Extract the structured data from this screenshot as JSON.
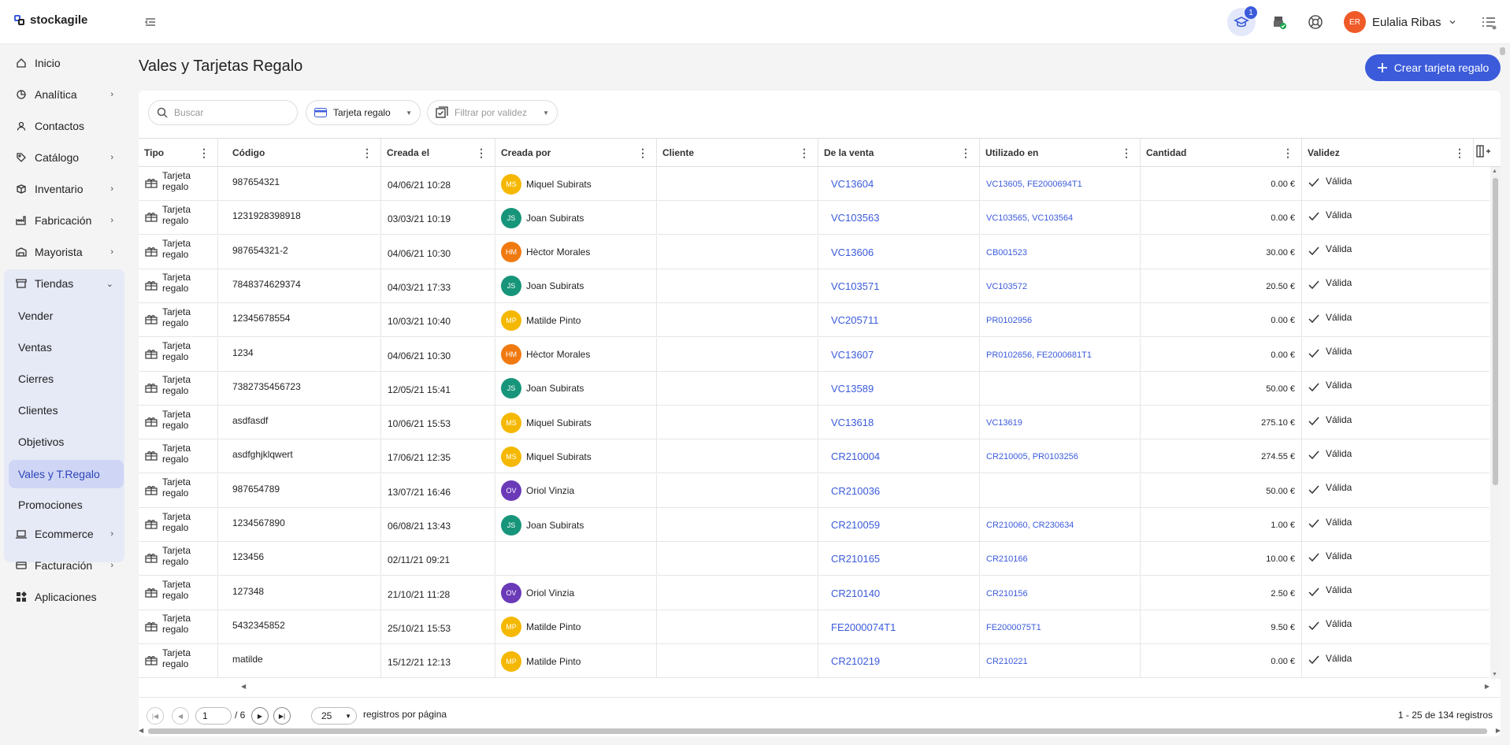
{
  "app": {
    "logo_text": "stockagile"
  },
  "header": {
    "academy_badge": "1",
    "user_initials": "ER",
    "user_name": "Eulalia Ribas"
  },
  "sidebar": {
    "items": [
      {
        "label": "Inicio",
        "icon": "home-icon"
      },
      {
        "label": "Analítica",
        "icon": "chart-icon"
      },
      {
        "label": "Contactos",
        "icon": "user-icon"
      },
      {
        "label": "Catálogo",
        "icon": "tag-icon"
      },
      {
        "label": "Inventario",
        "icon": "box-icon"
      },
      {
        "label": "Fabricación",
        "icon": "factory-icon"
      },
      {
        "label": "Mayorista",
        "icon": "warehouse-icon"
      },
      {
        "label": "Tiendas",
        "icon": "store-icon"
      },
      {
        "label": "Ecommerce",
        "icon": "laptop-icon"
      },
      {
        "label": "Facturación",
        "icon": "invoice-icon"
      },
      {
        "label": "Aplicaciones",
        "icon": "apps-icon"
      }
    ],
    "tiendas_sub": [
      "Vender",
      "Ventas",
      "Cierres",
      "Clientes",
      "Objetivos",
      "Vales y T.Regalo",
      "Promociones"
    ]
  },
  "page": {
    "title": "Vales y Tarjetas Regalo",
    "create_button": "Crear tarjeta regalo"
  },
  "filters": {
    "search_placeholder": "Buscar",
    "type_filter": "Tarjeta regalo",
    "validity_filter": "Filtrar por validez"
  },
  "table": {
    "columns": [
      "Tipo",
      "Código",
      "Creada el",
      "Creada por",
      "Cliente",
      "De la venta",
      "Utilizado en",
      "Cantidad",
      "Validez"
    ],
    "rows": [
      {
        "tipo": "Tarjeta regalo",
        "codigo": "987654321",
        "creada": "04/06/21 10:28",
        "ini": "MS",
        "por": "Miquel Subirats",
        "cliente": "",
        "venta": "VC13604",
        "usado": "VC13605, FE2000694T1",
        "cant": "0.00 €",
        "valid": "Válida"
      },
      {
        "tipo": "Tarjeta regalo",
        "codigo": "1231928398918",
        "creada": "03/03/21 10:19",
        "ini": "JS",
        "por": "Joan Subirats",
        "cliente": "",
        "venta": "VC103563",
        "usado": "VC103565, VC103564",
        "cant": "0.00 €",
        "valid": "Válida"
      },
      {
        "tipo": "Tarjeta regalo",
        "codigo": "987654321-2",
        "creada": "04/06/21 10:30",
        "ini": "HM",
        "por": "Hèctor Morales",
        "cliente": "",
        "venta": "VC13606",
        "usado": "CB001523",
        "cant": "30.00 €",
        "valid": "Válida"
      },
      {
        "tipo": "Tarjeta regalo",
        "codigo": "7848374629374",
        "creada": "04/03/21 17:33",
        "ini": "JS",
        "por": "Joan Subirats",
        "cliente": "",
        "venta": "VC103571",
        "usado": "VC103572",
        "cant": "20.50 €",
        "valid": "Válida"
      },
      {
        "tipo": "Tarjeta regalo",
        "codigo": "12345678554",
        "creada": "10/03/21 10:40",
        "ini": "MP",
        "por": "Matilde Pinto",
        "cliente": "",
        "venta": "VC205711",
        "usado": "PR0102956",
        "cant": "0.00 €",
        "valid": "Válida"
      },
      {
        "tipo": "Tarjeta regalo",
        "codigo": "1234",
        "creada": "04/06/21 10:30",
        "ini": "HM",
        "por": "Hèctor Morales",
        "cliente": "",
        "venta": "VC13607",
        "usado": "PR0102656, FE2000681T1",
        "cant": "0.00 €",
        "valid": "Válida"
      },
      {
        "tipo": "Tarjeta regalo",
        "codigo": "7382735456723",
        "creada": "12/05/21 15:41",
        "ini": "JS",
        "por": "Joan Subirats",
        "cliente": "",
        "venta": "VC13589",
        "usado": "",
        "cant": "50.00 €",
        "valid": "Válida"
      },
      {
        "tipo": "Tarjeta regalo",
        "codigo": "asdfasdf",
        "creada": "10/06/21 15:53",
        "ini": "MS",
        "por": "Miquel Subirats",
        "cliente": "",
        "venta": "VC13618",
        "usado": "VC13619",
        "cant": "275.10 €",
        "valid": "Válida"
      },
      {
        "tipo": "Tarjeta regalo",
        "codigo": "asdfghjklqwert",
        "creada": "17/06/21 12:35",
        "ini": "MS",
        "por": "Miquel Subirats",
        "cliente": "",
        "venta": "CR210004",
        "usado": "CR210005, PR0103256",
        "cant": "274.55 €",
        "valid": "Válida"
      },
      {
        "tipo": "Tarjeta regalo",
        "codigo": "987654789",
        "creada": "13/07/21 16:46",
        "ini": "OV",
        "por": "Oriol Vinzia",
        "cliente": "",
        "venta": "CR210036",
        "usado": "",
        "cant": "50.00 €",
        "valid": "Válida"
      },
      {
        "tipo": "Tarjeta regalo",
        "codigo": "1234567890",
        "creada": "06/08/21 13:43",
        "ini": "JS",
        "por": "Joan Subirats",
        "cliente": "",
        "venta": "CR210059",
        "usado": "CR210060, CR230634",
        "cant": "1.00 €",
        "valid": "Válida"
      },
      {
        "tipo": "Tarjeta regalo",
        "codigo": "123456",
        "creada": "02/11/21 09:21",
        "ini": "",
        "por": "",
        "cliente": "",
        "venta": "CR210165",
        "usado": "CR210166",
        "cant": "10.00 €",
        "valid": "Válida"
      },
      {
        "tipo": "Tarjeta regalo",
        "codigo": "127348",
        "creada": "21/10/21 11:28",
        "ini": "OV",
        "por": "Oriol Vinzia",
        "cliente": "",
        "venta": "CR210140",
        "usado": "CR210156",
        "cant": "2.50 €",
        "valid": "Válida"
      },
      {
        "tipo": "Tarjeta regalo",
        "codigo": "5432345852",
        "creada": "25/10/21 15:53",
        "ini": "MP",
        "por": "Matilde Pinto",
        "cliente": "",
        "venta": "FE2000074T1",
        "usado": "FE2000075T1",
        "cant": "9.50 €",
        "valid": "Válida"
      },
      {
        "tipo": "Tarjeta regalo",
        "codigo": "matilde",
        "creada": "15/12/21 12:13",
        "ini": "MP",
        "por": "Matilde Pinto",
        "cliente": "",
        "venta": "CR210219",
        "usado": "CR210221",
        "cant": "0.00 €",
        "valid": "Válida"
      }
    ]
  },
  "pagination": {
    "current_page": "1",
    "total_pages": "/ 6",
    "per_page": "25",
    "per_page_label": "registros por página",
    "range": "1 - 25 de 134 registros"
  },
  "colors": {
    "accent": "#3b5bdb",
    "avatar_MS": "#f5b800",
    "avatar_JS": "#17957a",
    "avatar_HM": "#f07a10",
    "avatar_MP": "#f5b800",
    "avatar_OV": "#6a3ab8",
    "user_avatar": "#f05a28"
  }
}
